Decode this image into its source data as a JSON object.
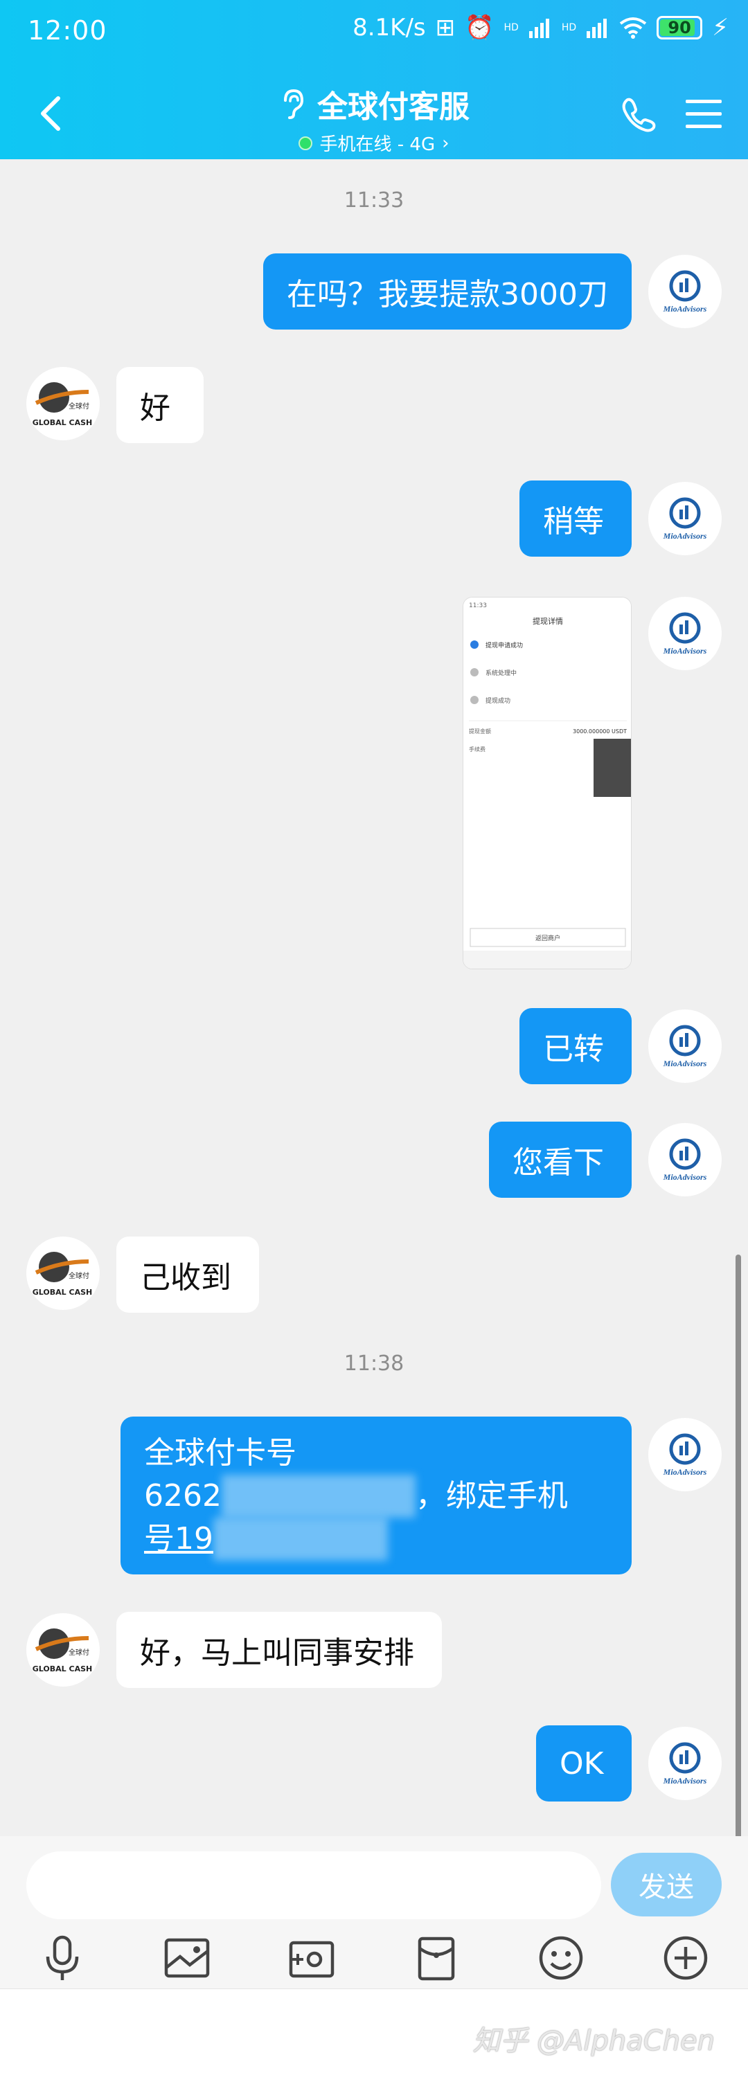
{
  "status_bar": {
    "time": "12:00",
    "network_speed": "8.1K/s",
    "hd1": "HD",
    "hd2": "HD",
    "battery": "90",
    "icons": [
      "nfc-icon",
      "alarm-icon",
      "signal-icon",
      "signal-icon",
      "wifi-icon",
      "battery-icon",
      "charging-icon"
    ]
  },
  "header": {
    "title": "全球付客服",
    "subtitle": "手机在线 - 4G",
    "icons": [
      "back-icon",
      "ear-icon",
      "phone-icon",
      "menu-icon"
    ],
    "color_start": "#0fc7f3",
    "color_end": "#27b4f6"
  },
  "contacts": {
    "me_avatar_text": "MioAdvisors",
    "them_avatar_brand": "全球付",
    "them_avatar_text": "GLOBAL CASH"
  },
  "messages": {
    "ts1": "11:33",
    "m1": "在吗？我要提款3000刀",
    "m2": "好",
    "m3": "稍等",
    "m5": "已转",
    "m6": "您看下",
    "m7": "己收到",
    "ts2": "11:38",
    "m8": {
      "line1": "全球付卡号",
      "line2_prefix": "6262",
      "line2_suffix": "，绑定手机",
      "line3_prefix": "号19"
    },
    "m9": "好，马上叫同事安排",
    "m10": "OK"
  },
  "screenshot_message": {
    "time": "11:33",
    "title": "提现详情",
    "steps": [
      "提现申请成功",
      "系统处理中",
      "提现成功"
    ],
    "amount_label": "提现金额",
    "amount_value": "3000.000000 USDT",
    "fee_label": "手续费",
    "footer_button": "返回商户"
  },
  "input": {
    "placeholder": "",
    "send_label": "发送",
    "send_color": "#8fd0f8"
  },
  "toolbar": {
    "icons": [
      "microphone-icon",
      "image-icon",
      "camera-icon",
      "red-packet-icon",
      "emoji-icon",
      "plus-icon"
    ]
  },
  "watermark": "知乎 @AlphaChen",
  "colors": {
    "my_bubble": "#1497f5",
    "their_bubble": "#ffffff",
    "background": "#f0f0f0"
  }
}
